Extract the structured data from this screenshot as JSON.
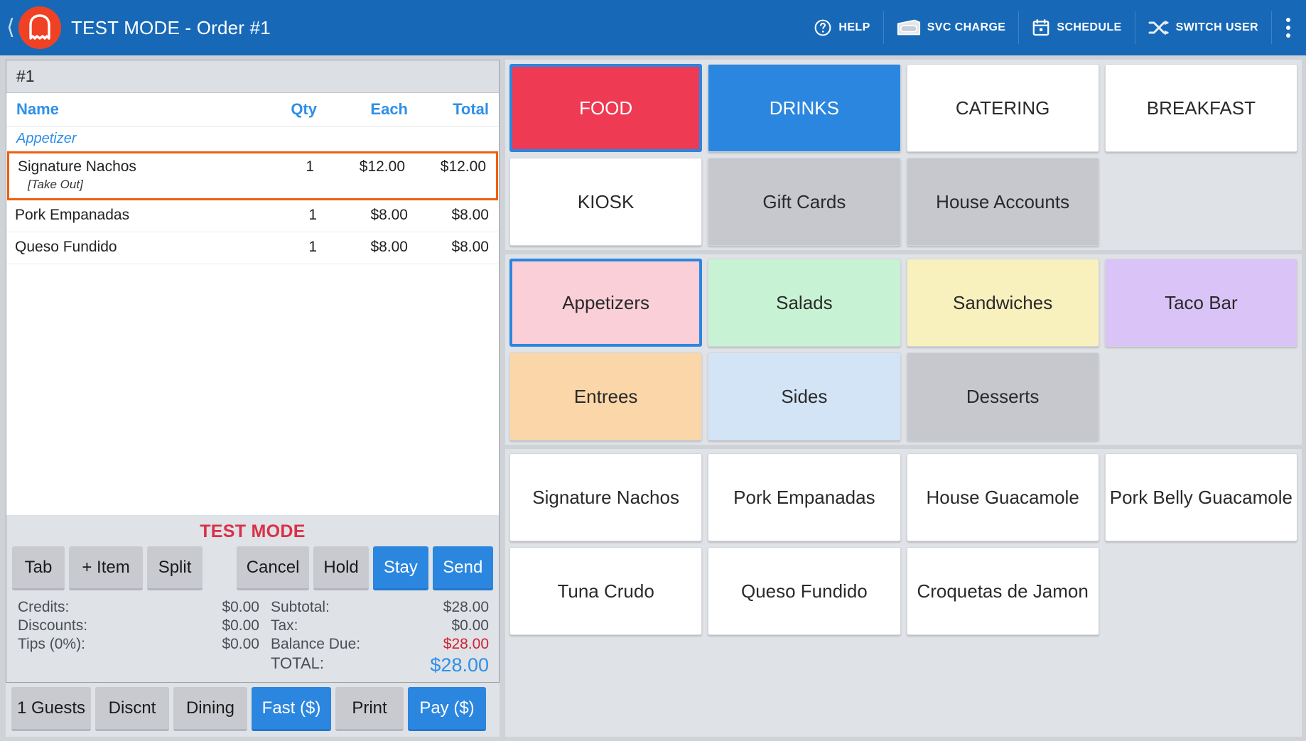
{
  "topbar": {
    "back_icon": "chevron-left-icon",
    "logo_icon": "bread-loaf-logo-icon",
    "title": "TEST MODE - Order #1",
    "items": [
      {
        "label": "HELP",
        "icon": "question-circle-icon"
      },
      {
        "label": "SVC CHARGE",
        "icon": "cash-bill-icon"
      },
      {
        "label": "SCHEDULE",
        "icon": "calendar-icon"
      },
      {
        "label": "SWITCH USER",
        "icon": "shuffle-arrows-icon"
      }
    ],
    "overflow_icon": "kebab-menu-icon",
    "bg_color": "#1769b8"
  },
  "ticket": {
    "tab_label": "#1",
    "columns": {
      "name": "Name",
      "qty": "Qty",
      "each": "Each",
      "total": "Total"
    },
    "group_label": "Appetizer",
    "lines": [
      {
        "name": "Signature Nachos",
        "modifier": "[Take Out]",
        "qty": "1",
        "each": "$12.00",
        "total": "$12.00",
        "selected": true
      },
      {
        "name": "Pork Empanadas",
        "modifier": "",
        "qty": "1",
        "each": "$8.00",
        "total": "$8.00",
        "selected": false
      },
      {
        "name": "Queso Fundido",
        "modifier": "",
        "qty": "1",
        "each": "$8.00",
        "total": "$8.00",
        "selected": false
      }
    ],
    "selection_color": "#ef5f12"
  },
  "footer": {
    "test_mode_banner": "TEST MODE",
    "test_mode_color": "#d93049",
    "action_buttons": [
      {
        "label": "Tab",
        "style": "default"
      },
      {
        "label": "+ Item",
        "style": "default"
      },
      {
        "label": "Split",
        "style": "default"
      },
      {
        "label": "Cancel",
        "style": "default"
      },
      {
        "label": "Hold",
        "style": "default"
      },
      {
        "label": "Stay",
        "style": "primary"
      },
      {
        "label": "Send",
        "style": "primary"
      }
    ],
    "totals": {
      "credits_label": "Credits:",
      "credits_value": "$0.00",
      "discounts_label": "Discounts:",
      "discounts_value": "$0.00",
      "tips_label": "Tips (0%):",
      "tips_value": "$0.00",
      "subtotal_label": "Subtotal:",
      "subtotal_value": "$28.00",
      "tax_label": "Tax:",
      "tax_value": "$0.00",
      "balance_label": "Balance Due:",
      "balance_value": "$28.00",
      "total_label": "TOTAL:",
      "total_value": "$28.00"
    },
    "bottom_buttons": [
      {
        "label": "1 Guests",
        "style": "default"
      },
      {
        "label": "Discnt",
        "style": "default"
      },
      {
        "label": "Dining",
        "style": "default"
      },
      {
        "label": "Fast ($)",
        "style": "primary"
      },
      {
        "label": "Print",
        "style": "default"
      },
      {
        "label": "Pay ($)",
        "style": "primary"
      }
    ]
  },
  "menu": {
    "categories": [
      {
        "label": "FOOD",
        "bg": "#ee3a52",
        "fg": "#ffffff",
        "selected": true
      },
      {
        "label": "DRINKS",
        "bg": "#2b86e0",
        "fg": "#ffffff",
        "selected": false
      },
      {
        "label": "CATERING",
        "bg": "#ffffff",
        "fg": "#2a2a2a",
        "selected": false
      },
      {
        "label": "BREAKFAST",
        "bg": "#ffffff",
        "fg": "#2a2a2a",
        "selected": false
      },
      {
        "label": "KIOSK",
        "bg": "#ffffff",
        "fg": "#2a2a2a",
        "selected": false
      },
      {
        "label": "Gift Cards",
        "bg": "#c6c8ce",
        "fg": "#2a2a2a",
        "selected": false
      },
      {
        "label": "House Accounts",
        "bg": "#c6c8ce",
        "fg": "#2a2a2a",
        "selected": false
      },
      {
        "label": "",
        "bg": "",
        "fg": "",
        "selected": false
      }
    ],
    "subcategories": [
      {
        "label": "Appetizers",
        "bg": "#fbcfd8",
        "fg": "#2a2a2a",
        "selected": true
      },
      {
        "label": "Salads",
        "bg": "#c8f2d4",
        "fg": "#2a2a2a",
        "selected": false
      },
      {
        "label": "Sandwiches",
        "bg": "#f8f0bd",
        "fg": "#2a2a2a",
        "selected": false
      },
      {
        "label": "Taco Bar",
        "bg": "#d9c3f7",
        "fg": "#2a2a2a",
        "selected": false
      },
      {
        "label": "Entrees",
        "bg": "#fbd6a8",
        "fg": "#2a2a2a",
        "selected": false
      },
      {
        "label": "Sides",
        "bg": "#d3e4f7",
        "fg": "#2a2a2a",
        "selected": false
      },
      {
        "label": "Desserts",
        "bg": "#c6c8ce",
        "fg": "#2a2a2a",
        "selected": false
      },
      {
        "label": "",
        "bg": "",
        "fg": "",
        "selected": false
      }
    ],
    "items": [
      {
        "label": "Signature Nachos"
      },
      {
        "label": "Pork Empanadas"
      },
      {
        "label": "House Guacamole"
      },
      {
        "label": "Pork Belly Guacamole"
      },
      {
        "label": "Tuna Crudo"
      },
      {
        "label": "Queso Fundido"
      },
      {
        "label": "Croquetas de Jamon"
      },
      {
        "label": ""
      }
    ]
  }
}
